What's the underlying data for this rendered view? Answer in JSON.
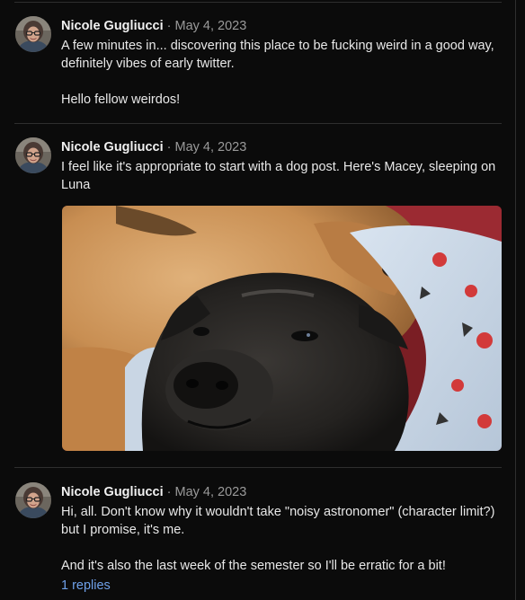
{
  "posts": [
    {
      "author": "Nicole Gugliucci",
      "separator": "·",
      "date": "May 4, 2023",
      "paragraphs": [
        "A few minutes in... discovering this place to be fucking weird in a good way, definitely vibes of early twitter.",
        "Hello fellow weirdos!"
      ]
    },
    {
      "author": "Nicole Gugliucci",
      "separator": "·",
      "date": "May 4, 2023",
      "paragraphs": [
        "I feel like it's appropriate to start with a dog post. Here's Macey, sleeping on Luna"
      ],
      "image": "photo of two dogs sleeping"
    },
    {
      "author": "Nicole Gugliucci",
      "separator": "·",
      "date": "May 4, 2023",
      "paragraphs": [
        "Hi, all. Don't know why it wouldn't take \"noisy astronomer\" (character limit?) but I promise, it's me.",
        "And it's also the last week of the semester so I'll be erratic for a bit!"
      ],
      "replies_label": "1 replies"
    }
  ],
  "colors": {
    "background": "#0b0b0b",
    "author": "#f2f2f2",
    "date": "#9a9a9a",
    "link": "#6ea0e8"
  }
}
